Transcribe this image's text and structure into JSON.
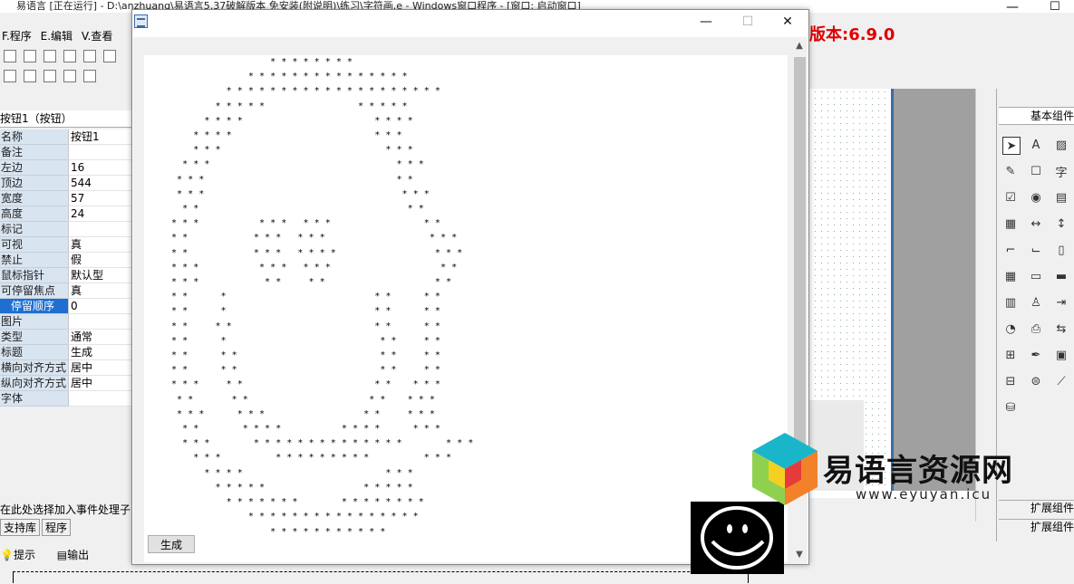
{
  "ide": {
    "title": "易语言 [正在运行] - D:\\anzhuang\\易语言5.37破解版本 免安装(附说明)\\练习\\字符画.e - Windows窗口程序 - [窗口: 启动窗口]",
    "menu": [
      "F.程序",
      "E.编辑",
      "V.查看"
    ],
    "version": "版本:6.9.0",
    "property_title": "按钮1（按钮）",
    "properties": [
      {
        "k": "名称",
        "v": "按钮1"
      },
      {
        "k": "备注",
        "v": ""
      },
      {
        "k": "左边",
        "v": "16"
      },
      {
        "k": "顶边",
        "v": "544"
      },
      {
        "k": "宽度",
        "v": "57"
      },
      {
        "k": "高度",
        "v": "24"
      },
      {
        "k": "标记",
        "v": ""
      },
      {
        "k": "可视",
        "v": "真"
      },
      {
        "k": "禁止",
        "v": "假"
      },
      {
        "k": "鼠标指针",
        "v": "默认型"
      },
      {
        "k": "可停留焦点",
        "v": "真"
      },
      {
        "k": "停留顺序",
        "v": "0"
      },
      {
        "k": "图片",
        "v": ""
      },
      {
        "k": "类型",
        "v": "通常"
      },
      {
        "k": "标题",
        "v": "生成"
      },
      {
        "k": "横向对齐方式",
        "v": "居中"
      },
      {
        "k": "纵向对齐方式",
        "v": "居中"
      },
      {
        "k": "字体",
        "v": ""
      }
    ],
    "event_hint": "在此处选择加入事件处理子",
    "bottom_tabs": [
      "支持库",
      "程序",
      ""
    ],
    "output_tabs": [
      "提示",
      "输出"
    ],
    "component_header": "基本组件",
    "component_ext1": "扩展组件",
    "component_ext2": "扩展组件"
  },
  "window": {
    "button_label": "生成",
    "minimize": "—",
    "maximize": "☐",
    "close": "✕",
    "ascii_art": "                  * * * * * * * *\n              * * * * * * * * * * * * * * *\n          * * * * * * * * * * * * * * * * * * * *\n        * * * * *                 * * * * *\n      * * * *                        * * * *\n    * * * *                          * * *\n    * * *                              * * *\n  * * *                                  * * *\n * * *                                   * *\n * * *                                    * * *\n  * *                                      * *\n* * *           * * *   * * *                 * *\n* *            * * *   * * *                   * * *\n* *            * * *   * * * *                  * * *\n* * *           * * *   * * *                    * *\n* * *            * *     * *                    * *\n* *      *                           * *      * *\n* *      *                           * *      * *\n* *     * *                          * *      * *\n* *      *                            * *     * *\n* *      * *                          * *     * *\n* *      * *                          * *     * *\n* * *     * *                        * *    * * *\n * *       * *                      * *    * * *\n * * *      * * *                  * *     * * *\n  * *        * * * *           * * * *      * * *\n  * * *        * * * * * * * * * * * * * *        * * *\n    * * *          * * * * * * * * *          * * *\n      * * * *                          * * *\n        * * * * *                  * * * * *\n          * * * * * * *        * * * * * * * *\n              * * * * * * * * * * * * * * * *\n                  * * * * * * * * * * *"
  },
  "watermark": {
    "text": "易语言资源网",
    "url": "www.eyuyan.icu"
  },
  "colors": {
    "version_red": "#e00000",
    "selected_blue": "#1e6fd0",
    "prop_key_bg": "#d8e4f0"
  }
}
